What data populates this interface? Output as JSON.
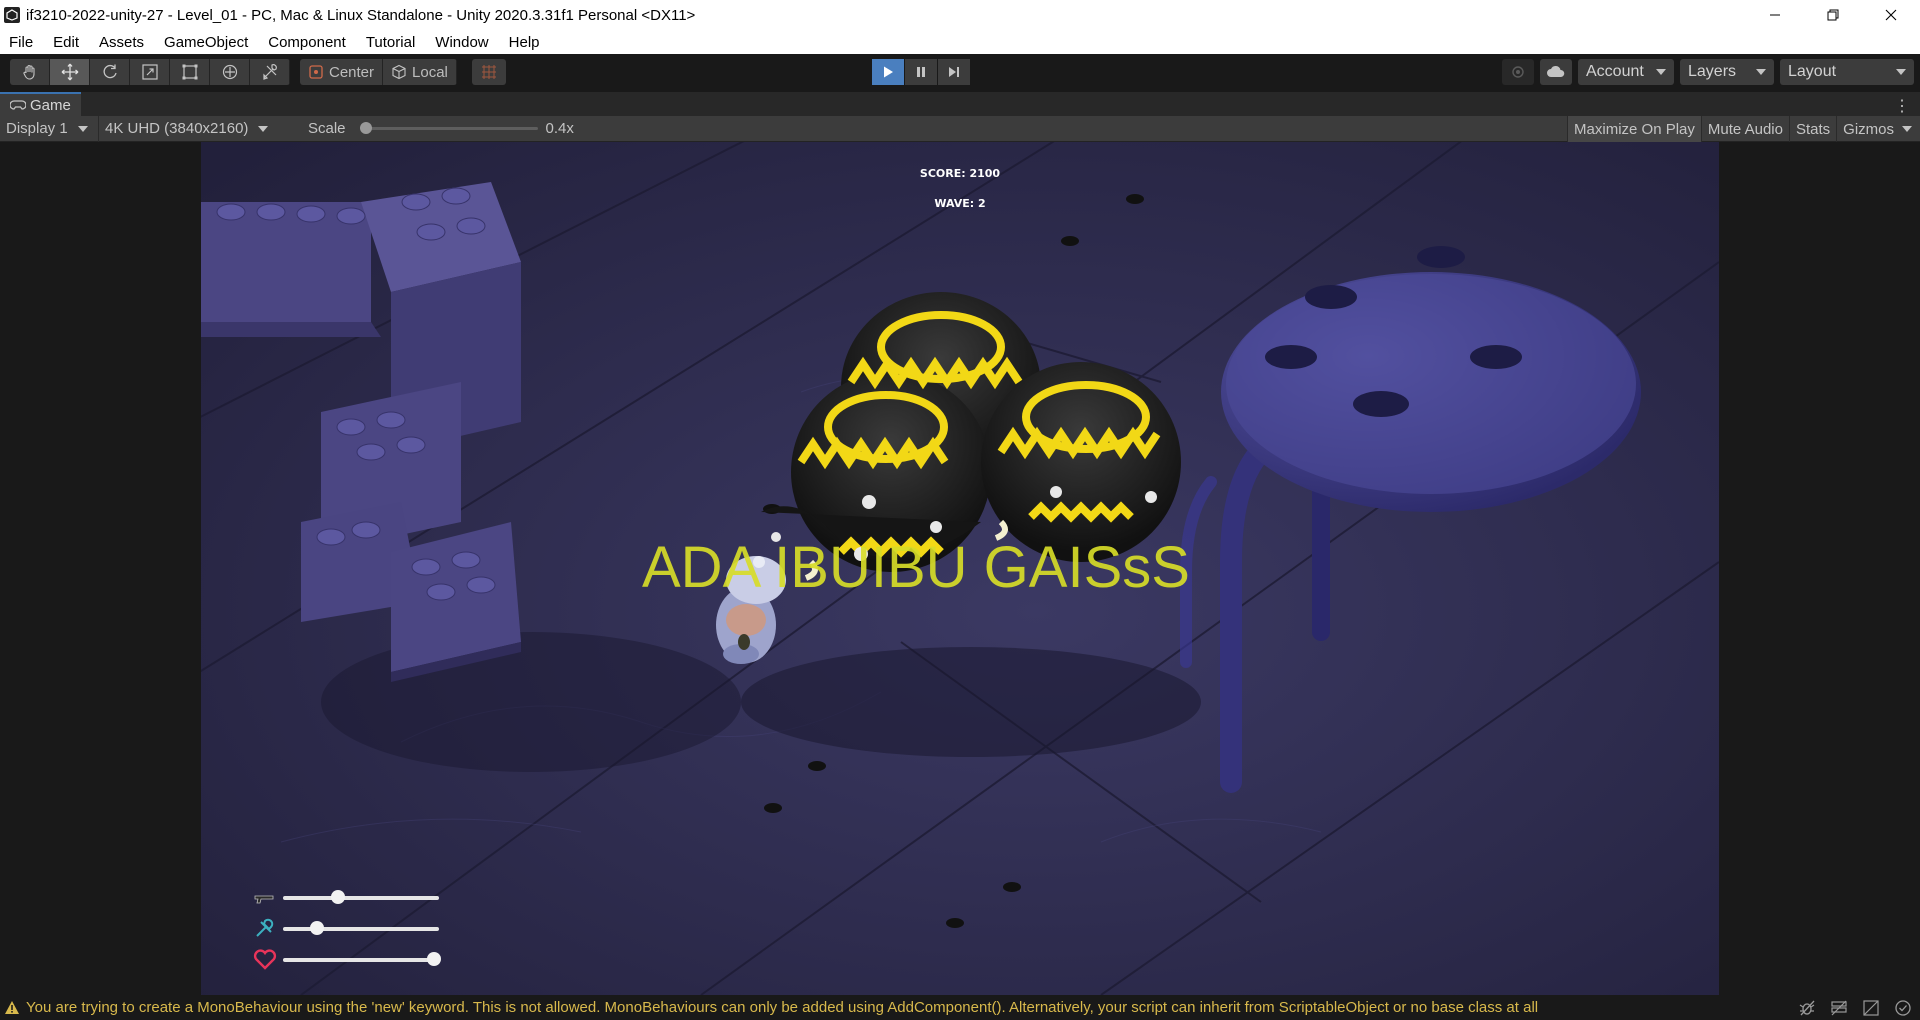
{
  "window": {
    "title": "if3210-2022-unity-27 - Level_01 - PC, Mac & Linux Standalone - Unity 2020.3.31f1 Personal <DX11>"
  },
  "menu": [
    "File",
    "Edit",
    "Assets",
    "GameObject",
    "Component",
    "Tutorial",
    "Window",
    "Help"
  ],
  "toolbar": {
    "tools": [
      "hand-tool-icon",
      "move-tool-icon",
      "rotate-tool-icon",
      "scale-tool-icon",
      "rect-tool-icon",
      "transform-tool-icon",
      "custom-tool-icon"
    ],
    "pivot_label": "Center",
    "space_label": "Local",
    "account_label": "Account",
    "layers_label": "Layers",
    "layout_label": "Layout",
    "play_active": true
  },
  "game_view": {
    "tab_label": "Game",
    "display": "Display 1",
    "resolution": "4K UHD (3840x2160)",
    "scale_label": "Scale",
    "scale_value": "0.4x",
    "toggles": [
      "Maximize On Play",
      "Mute Audio",
      "Stats",
      "Gizmos"
    ],
    "maximize_on_play_active": true
  },
  "hud": {
    "score": "SCORE: 2100",
    "wave": "WAVE: 2",
    "banner": "ADA IBUIBU GAISsS",
    "sliders": [
      {
        "icon": "gun-icon",
        "level": 0.35
      },
      {
        "icon": "speed-icon",
        "level": 0.22
      },
      {
        "icon": "heart-icon",
        "level": 0.97
      }
    ]
  },
  "colors": {
    "accent": "#4a7fbf",
    "warning": "#d8b94c",
    "banner": "#d7dc28",
    "floor": "#2e2c4f",
    "heart": "#e8345a"
  },
  "console": {
    "message": "You are trying to create a MonoBehaviour using the 'new' keyword.  This is not allowed.  MonoBehaviours can only be added using AddComponent(). Alternatively, your script can inherit from ScriptableObject or no base class at all"
  }
}
